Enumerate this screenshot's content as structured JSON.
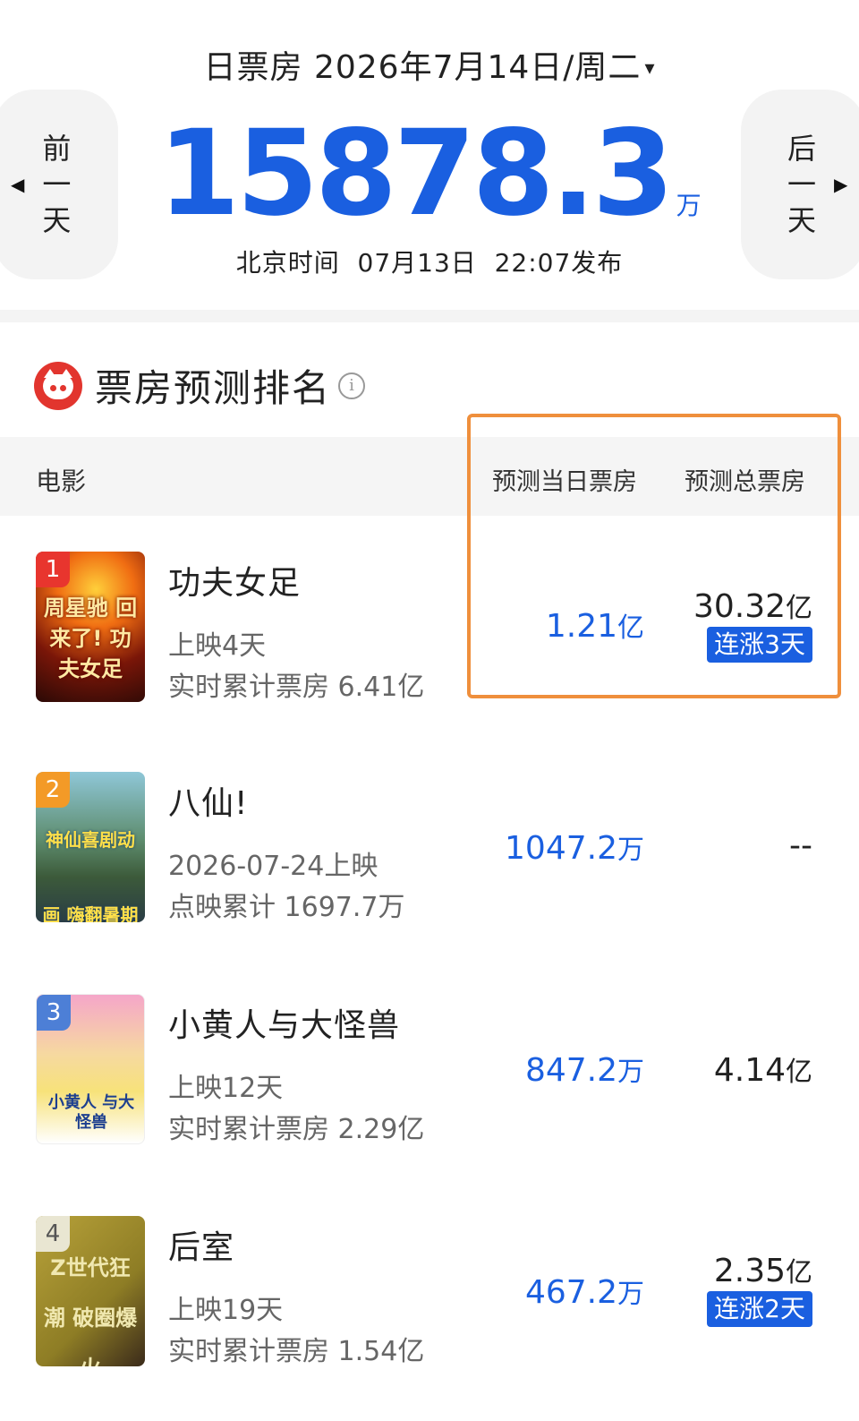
{
  "header": {
    "date_prefix": "日票房",
    "date": "2026年7月14日/周二",
    "caret": "▾",
    "prev_chars": [
      "前",
      "一",
      "天"
    ],
    "next_chars": [
      "后",
      "一",
      "天"
    ],
    "prev_arrow": "◀",
    "next_arrow": "▶",
    "total_value": "15878.3",
    "total_unit": "万",
    "published": "北京时间  07月13日  22:07发布"
  },
  "ranking": {
    "title": "票房预测排名",
    "info_icon": "i",
    "columns": {
      "movie": "电影",
      "day": "预测当日票房",
      "total": "预测总票房"
    },
    "rows": [
      {
        "rank": "1",
        "poster_text": "周星驰 回来了! 功夫女足",
        "name": "功夫女足",
        "sub1": "上映4天",
        "sub2": "实时累计票房 6.41亿",
        "day_num": "1.21",
        "day_unit": "亿",
        "total_num": "30.32",
        "total_unit": "亿",
        "badge": "连涨3天"
      },
      {
        "rank": "2",
        "poster_text": "神仙喜剧动画 嗨翻暑期",
        "name": "八仙!",
        "sub1": "2026-07-24上映",
        "sub2": "点映累计 1697.7万",
        "day_num": "1047.2",
        "day_unit": "万",
        "total_num": "--",
        "total_unit": "",
        "badge": ""
      },
      {
        "rank": "3",
        "poster_text": "小黄人 与大怪兽",
        "name": "小黄人与大怪兽",
        "sub1": "上映12天",
        "sub2": "实时累计票房 2.29亿",
        "day_num": "847.2",
        "day_unit": "万",
        "total_num": "4.14",
        "total_unit": "亿",
        "badge": ""
      },
      {
        "rank": "4",
        "poster_text": "Z世代狂潮 破圈爆火",
        "name": "后室",
        "sub1": "上映19天",
        "sub2": "实时累计票房 1.54亿",
        "day_num": "467.2",
        "day_unit": "万",
        "total_num": "2.35",
        "total_unit": "亿",
        "badge": "连涨2天"
      }
    ]
  },
  "colors": {
    "accent_blue": "#1a5fe0",
    "highlight_orange": "#ef8f3c",
    "logo_red": "#e2352e"
  }
}
